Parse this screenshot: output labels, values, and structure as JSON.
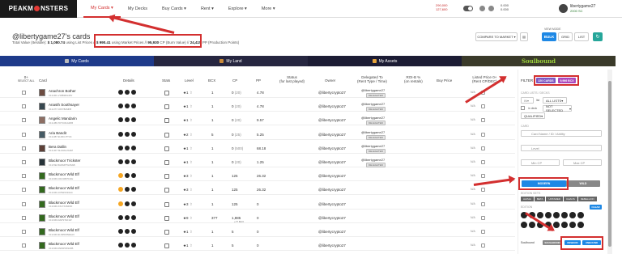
{
  "nav": {
    "logo": "PEAKMONSTERS",
    "items": [
      "My Cards",
      "My Decks",
      "Buy Cards",
      "Rent",
      "Explore",
      "More"
    ],
    "active": 0
  },
  "balances": {
    "a1": "290,000",
    "a2": "127,600",
    "b1": "0.000",
    "b2": "0.000"
  },
  "user": {
    "name": "libertygame27",
    "sub": "2000 SC"
  },
  "page": {
    "title": "@libertygame27's cards",
    "total_prefix": "Total Value (Iterable):",
    "total_value": "$ 1,080.74",
    "total_mid": "using List Prices //",
    "market_value": "$ 990.41",
    "market_label": "using Market Prices //",
    "burn_value": "95,930",
    "burn_label": "CP (Burn Value) //",
    "pp_value": "24,415",
    "pp_label": "PP (Production Points)"
  },
  "toolbar": {
    "viewmode": "VIEW MODE",
    "compare": "COMPARE TO MARKET",
    "bulk": "BULK",
    "grid": "GRID",
    "list": "LIST"
  },
  "tabs": [
    "My Cards",
    "My Land",
    "My Assets",
    "Soulbound"
  ],
  "columns": {
    "select": "0+",
    "select2": "SELECT ALL",
    "card": "Card",
    "details": "Details",
    "stats": "Stats",
    "level": "Level",
    "bcx": "BCX",
    "cp": "CP",
    "pp": "PP",
    "status": "Status",
    "status2": "(for last played)",
    "owner": "Owner",
    "delegated": "Delegated To",
    "delegated2": "(Rent Type / Time)",
    "roi": "ROI-B %",
    "roi2": "(on rentals)",
    "buy": "Buy Price",
    "listed": "Listed Price",
    "listed2": "(Rent CP/DEC)"
  },
  "rows": [
    {
      "name": "Anachron Bother",
      "id": "C13-001-V16B3DG40V",
      "level": "1",
      "bcx": "1",
      "cp": "0",
      "cpx": "(20)",
      "pp": "4.78",
      "owner": "@libertycrypto27",
      "deleg": "@libertygame27",
      "badge": "DELEGATED",
      "buy": "N/A"
    },
    {
      "name": "Anasth Soothsayer",
      "id": "C13-077-C0ST8AMFB",
      "level": "1",
      "bcx": "1",
      "cp": "0",
      "cpx": "(20)",
      "pp": "4.78",
      "owner": "@libertycrypto27",
      "deleg": "@libertygame27",
      "badge": "DELEGATED",
      "buy": "N/A"
    },
    {
      "name": "Angelic Mandarin",
      "id": "C13-389-7DTU3GG3KB",
      "level": "1",
      "bcx": "1",
      "cp": "0",
      "cpx": "(20)",
      "pp": "9.57",
      "owner": "@libertycrypto27",
      "deleg": "@libertygame27",
      "badge": "DELEGATED",
      "buy": "N/A"
    },
    {
      "name": "Aria Bandit",
      "id": "C13-087-9LK6CJ7TU4",
      "level": "2",
      "bcx": "5",
      "cp": "0",
      "cpx": "(25)",
      "pp": "5.25",
      "owner": "@libertycrypto27",
      "deleg": "@libertygame27",
      "badge": "DELEGATED",
      "buy": "N/A"
    },
    {
      "name": "Bera Dallin",
      "id": "C13-407-SLG6AL2G3M",
      "level": "1",
      "bcx": "1",
      "cp": "0",
      "cpx": "(500)",
      "pp": "68.18",
      "owner": "@libertycrypto27",
      "deleg": "@libertygame27",
      "badge": "DELEGATED",
      "buy": "N/A"
    },
    {
      "name": "Blackmoor Trickster",
      "id": "C13-592-5HNMPTG0SAB",
      "level": "1",
      "bcx": "1",
      "cp": "0",
      "cpx": "(20)",
      "pp": "1.25",
      "owner": "@libertycrypto27",
      "deleg": "@libertygame27",
      "badge": "DELEGATED",
      "buy": "N/A"
    },
    {
      "name": "Blackmoor Wild Elf",
      "id": "C13-660-C0U3JB7F4JH",
      "level": "3",
      "bcx": "1",
      "cp": "125",
      "cpx": "",
      "pp": "26.32",
      "owner": "@libertycrypto27",
      "deleg": "",
      "badge": "",
      "buy": "N/A"
    },
    {
      "name": "Blackmoor Wild Elf",
      "id": "C13-660-JU5W3XZ4AC",
      "level": "3",
      "bcx": "1",
      "cp": "125",
      "cpx": "",
      "pp": "26.32",
      "owner": "@libertycrypto27",
      "deleg": "",
      "badge": "",
      "buy": "N/A"
    },
    {
      "name": "Blackmoor Wild Elf",
      "id": "C13-660-XXLTX4NFFD",
      "level": "3",
      "bcx": "1",
      "cp": "125",
      "cpx": "",
      "pp": "0",
      "owner": "@libertycrypto27",
      "deleg": "",
      "badge": "",
      "buy": "N/A"
    },
    {
      "name": "Blackmoor Wild Elf",
      "id": "C13-660-DAPSTAF1W",
      "level": "9",
      "bcx": "377",
      "cp": "1,885",
      "cp_note": "+77 BCX",
      "cpx": "",
      "pp": "0",
      "owner": "@libertycrypto27",
      "deleg": "",
      "badge": "",
      "buy": "N/A"
    },
    {
      "name": "Blackmoor Wild Elf",
      "id": "C13-660-9LNP0K8WHAX",
      "level": "1",
      "bcx": "1",
      "cp": "5",
      "cpx": "",
      "pp": "0",
      "owner": "@libertycrypto27",
      "deleg": "",
      "badge": "",
      "buy": "N/A"
    },
    {
      "name": "Blackmoor Wild Elf",
      "id": "C13-660-DWSP3K94XB",
      "level": "1",
      "bcx": "1",
      "cp": "5",
      "cpx": "",
      "pp": "0",
      "owner": "@libertycrypto27",
      "deleg": "",
      "badge": "",
      "buy": "N/A"
    }
  ],
  "filters": {
    "label": "FILTER",
    "cards_badge": "220 CARDS",
    "bcx_badge": "9,966 BCX",
    "lists_label": "CARD LISTS / DECKS",
    "in": "IN",
    "list_label": "list",
    "all_lists": "ALL LISTS",
    "in_deck": "in deck",
    "not_selected": "NOT SELECTED",
    "qualified": "QUALIFIED",
    "card_label": "CARD",
    "card_placeholder": "Card Name / ID / Ability",
    "level_placeholder": "Level",
    "min_cp": "Min CP",
    "max_cp": "Max CP",
    "modern": "MODERN",
    "wild": "WILD",
    "edition_label": "EDITION SETS",
    "editions": [
      "ALPHA",
      "BETA",
      "UNTAMED",
      "CHAOS",
      "REBELLION"
    ],
    "edition_label2": "EDITION",
    "clear": "CLEAR",
    "soulbound_label": "Soulbound",
    "soulbound_opts": [
      "SOULBOUND",
      "REWARD",
      "UNBOUND"
    ]
  }
}
